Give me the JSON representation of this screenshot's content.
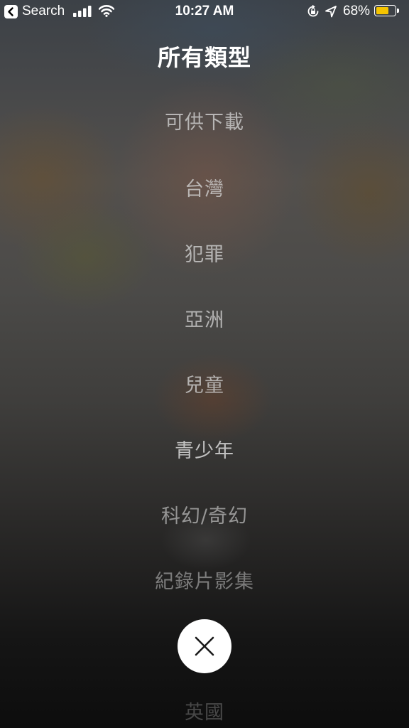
{
  "status_bar": {
    "back_app_label": "Search",
    "time": "10:27 AM",
    "battery_percent": "68%",
    "battery_level": 0.68,
    "battery_color": "#f5c400",
    "icons": [
      "back-chevron-icon",
      "signal-bars-icon",
      "wifi-icon",
      "orientation-lock-icon",
      "location-arrow-icon",
      "battery-icon"
    ]
  },
  "header": {
    "title": "所有類型"
  },
  "genres": [
    "可供下載",
    "台灣",
    "犯罪",
    "亞洲",
    "兒童",
    "青少年",
    "科幻/奇幻",
    "紀錄片影集",
    "英國"
  ],
  "close_button": {
    "icon": "close-icon"
  }
}
